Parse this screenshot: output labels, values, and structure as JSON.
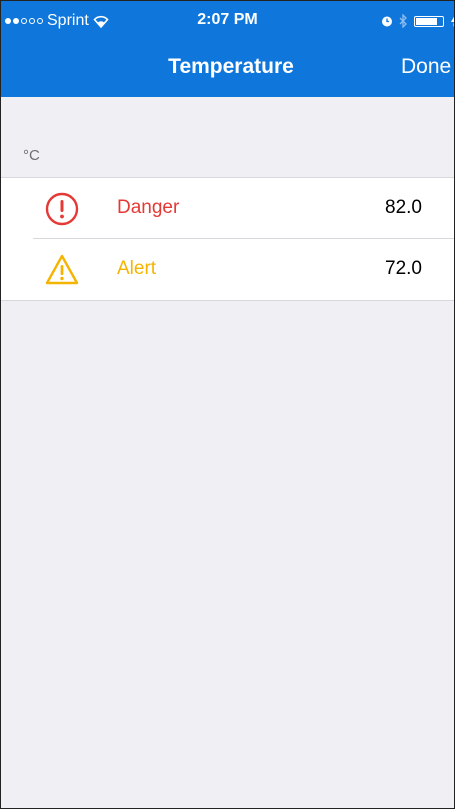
{
  "status_bar": {
    "signal_strength": 2,
    "signal_max": 5,
    "carrier": "Sprint",
    "time": "2:07 PM",
    "icons": [
      "wifi-icon",
      "alarm-icon",
      "bluetooth-icon",
      "battery-icon",
      "charging-icon"
    ],
    "battery_level": 0.8
  },
  "nav": {
    "title": "Temperature",
    "done_label": "Done"
  },
  "section": {
    "header": "°C"
  },
  "thresholds": [
    {
      "label": "Danger",
      "value": "82.0",
      "icon": "danger-icon",
      "color": "#e53935"
    },
    {
      "label": "Alert",
      "value": "72.0",
      "icon": "alert-icon",
      "color": "#f5b400"
    }
  ],
  "colors": {
    "nav_background": "#0f77dc",
    "page_background": "#efeff4"
  }
}
